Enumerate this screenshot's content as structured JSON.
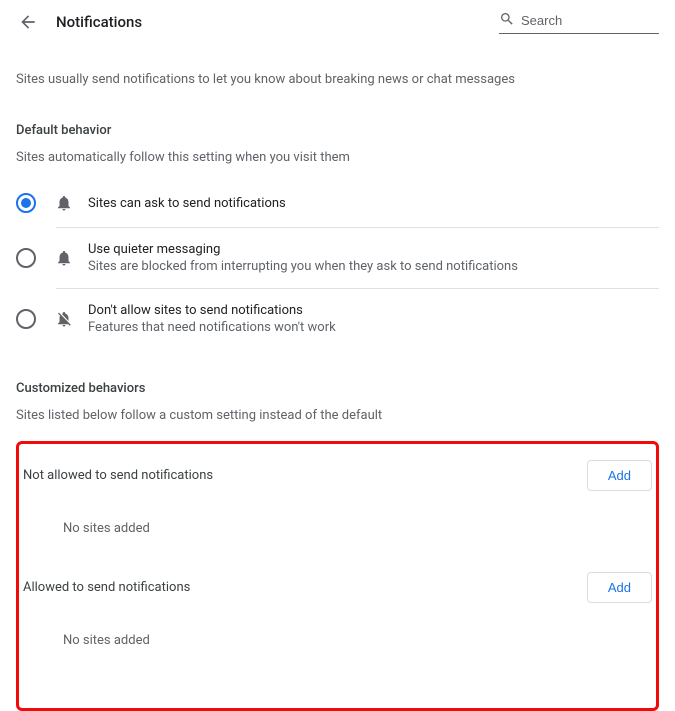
{
  "header": {
    "title": "Notifications",
    "search_placeholder": "Search"
  },
  "intro": "Sites usually send notifications to let you know about breaking news or chat messages",
  "default_behavior": {
    "title": "Default behavior",
    "subtitle": "Sites automatically follow this setting when you visit them",
    "options": [
      {
        "label": "Sites can ask to send notifications",
        "desc": "",
        "selected": true
      },
      {
        "label": "Use quieter messaging",
        "desc": "Sites are blocked from interrupting you when they ask to send notifications",
        "selected": false
      },
      {
        "label": "Don't allow sites to send notifications",
        "desc": "Features that need notifications won't work",
        "selected": false
      }
    ]
  },
  "customized": {
    "title": "Customized behaviors",
    "subtitle": "Sites listed below follow a custom setting instead of the default",
    "blocked": {
      "title": "Not allowed to send notifications",
      "add_label": "Add",
      "empty": "No sites added"
    },
    "allowed": {
      "title": "Allowed to send notifications",
      "add_label": "Add",
      "empty": "No sites added"
    }
  }
}
